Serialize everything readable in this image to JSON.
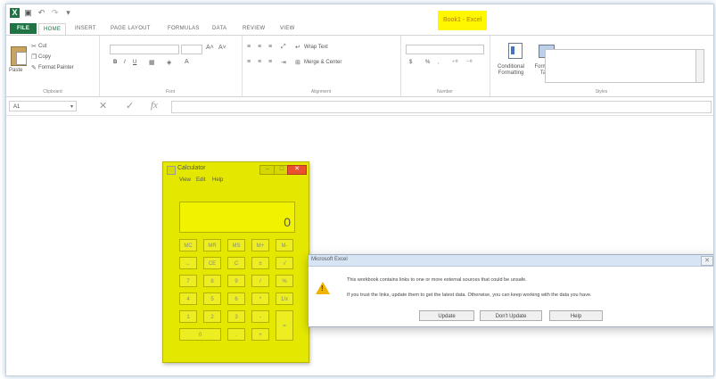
{
  "app": {
    "window_title": "Book1 - Excel"
  },
  "ribbon_tabs": [
    "FILE",
    "HOME",
    "INSERT",
    "PAGE LAYOUT",
    "FORMULAS",
    "DATA",
    "REVIEW",
    "VIEW"
  ],
  "clipboard": {
    "paste": "Paste",
    "cut": "Cut",
    "copy": "Copy",
    "format_painter": "Format Painter",
    "label": "Clipboard"
  },
  "font": {
    "label": "Font",
    "bold": "B",
    "italic": "I",
    "underline": "U"
  },
  "alignment": {
    "wrap_text": "Wrap Text",
    "merge_center": "Merge & Center",
    "label": "Alignment"
  },
  "number": {
    "currency": "$",
    "percent": "%",
    "comma": ",",
    "label": "Number"
  },
  "styles": {
    "conditional_formatting": "Conditional Formatting",
    "format_as_table": "Format as Table",
    "label": "Styles"
  },
  "formula_bar": {
    "name_box": "A1",
    "cancel": "✕",
    "enter": "✓",
    "fx": "fx"
  },
  "calculator": {
    "title": "Calculator",
    "menu": [
      "View",
      "Edit",
      "Help"
    ],
    "display": "0",
    "keys_row1": [
      "MC",
      "MR",
      "MS",
      "M+",
      "M-"
    ],
    "keys_row2": [
      "←",
      "CE",
      "C",
      "±",
      "√"
    ],
    "keys_row3": [
      "7",
      "8",
      "9",
      "/",
      "%"
    ],
    "keys_row4": [
      "4",
      "5",
      "6",
      "*",
      "1/x"
    ],
    "keys_row5": [
      "1",
      "2",
      "3",
      "-",
      "="
    ],
    "keys_row6": [
      "0",
      ".",
      "+"
    ],
    "close": "✕",
    "minimize": "–",
    "maximize": "□"
  },
  "dialog": {
    "title": "Microsoft Excel",
    "line1": "This workbook contains links to one or more external sources that could be unsafe.",
    "line2": "If you trust the links, update them to get the latest data. Otherwise, you can keep working with the data you have.",
    "buttons": [
      "Update",
      "Don't Update",
      "Help"
    ],
    "close": "✕",
    "warning": "!"
  },
  "colors": {
    "excel_green": "#217346",
    "calculator_yellow": "#e4e800",
    "title_highlight": "#fff700"
  }
}
